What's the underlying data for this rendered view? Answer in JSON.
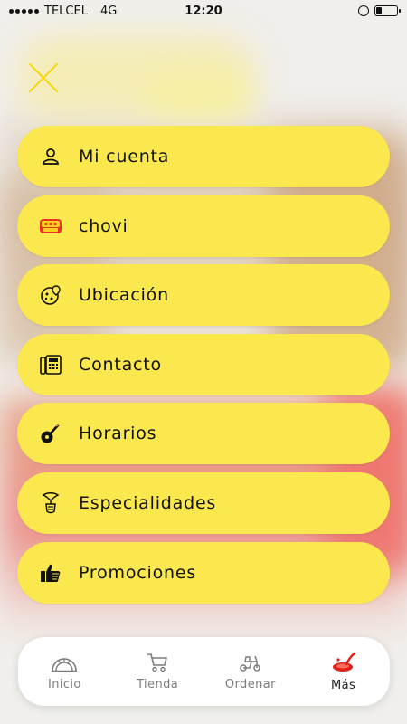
{
  "status_bar": {
    "carrier": "TELCEL",
    "network": "4G",
    "time": "12:20"
  },
  "menu": {
    "items": [
      {
        "label": "Mi cuenta",
        "icon": "user-icon"
      },
      {
        "label": "chovi",
        "icon": "brand-logo-icon"
      },
      {
        "label": "Ubicación",
        "icon": "pizza-location-icon"
      },
      {
        "label": "Contacto",
        "icon": "phone-icon"
      },
      {
        "label": "Horarios",
        "icon": "pizza-cutter-icon"
      },
      {
        "label": "Especialidades",
        "icon": "hand-pizza-icon"
      },
      {
        "label": "Promociones",
        "icon": "thumbs-up-icon"
      }
    ]
  },
  "tabbar": {
    "tabs": [
      {
        "label": "Inicio",
        "icon": "oven-icon",
        "active": false
      },
      {
        "label": "Tienda",
        "icon": "cart-icon",
        "active": false
      },
      {
        "label": "Ordenar",
        "icon": "scooter-icon",
        "active": false
      },
      {
        "label": "Más",
        "icon": "sauce-ladle-icon",
        "active": true
      }
    ]
  },
  "colors": {
    "menu_item_bg": "#fbe74e",
    "close_icon": "#f5d90a",
    "active_tab_icon": "#e0201a",
    "inactive_tab": "#7d7d7d"
  }
}
